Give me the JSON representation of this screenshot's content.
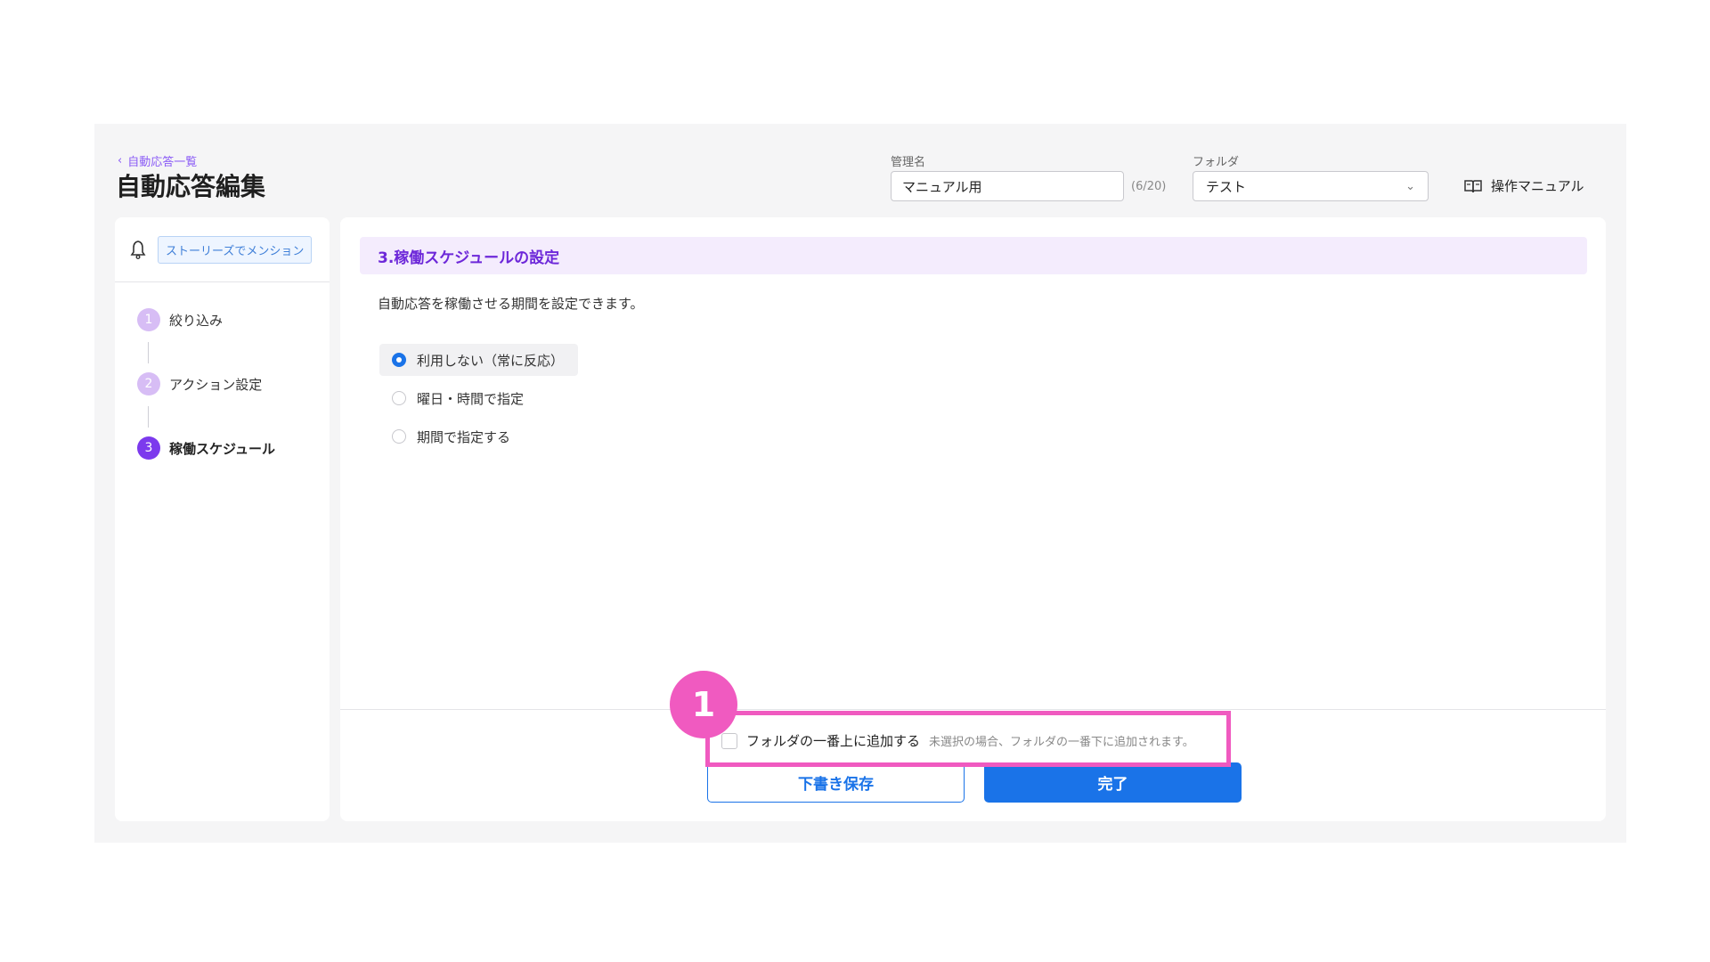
{
  "header": {
    "back_label": "自動応答一覧",
    "title": "自動応答編集",
    "name_label": "管理名",
    "name_value": "マニュアル用",
    "name_counter": "(6/20)",
    "folder_label": "フォルダ",
    "folder_value": "テスト",
    "manual_label": "操作マニュアル"
  },
  "sidebar": {
    "trigger_icon": "bell-icon",
    "trigger_tag": "ストーリーズでメンション",
    "steps": [
      {
        "num": "1",
        "label": "絞り込み"
      },
      {
        "num": "2",
        "label": "アクション設定"
      },
      {
        "num": "3",
        "label": "稼働スケジュール"
      }
    ],
    "active_step": "3"
  },
  "main": {
    "section_title": "3.稼働スケジュールの設定",
    "section_desc": "自動応答を稼働させる期間を設定できます。",
    "options": [
      {
        "label": "利用しない（常に反応）",
        "selected": true
      },
      {
        "label": "曜日・時間で指定",
        "selected": false
      },
      {
        "label": "期間で指定する",
        "selected": false
      }
    ]
  },
  "footer": {
    "checkbox_label": "フォルダの一番上に追加する",
    "checkbox_checked": false,
    "checkbox_note": "未選択の場合、フォルダの一番下に追加されます。",
    "draft_button": "下書き保存",
    "done_button": "完了"
  },
  "annotation": {
    "badge_number": "1",
    "color": "#f05ac0"
  },
  "colors": {
    "accent_purple": "#7c3aed",
    "primary_blue": "#1a73e8",
    "section_bg": "#f4ecfd"
  }
}
